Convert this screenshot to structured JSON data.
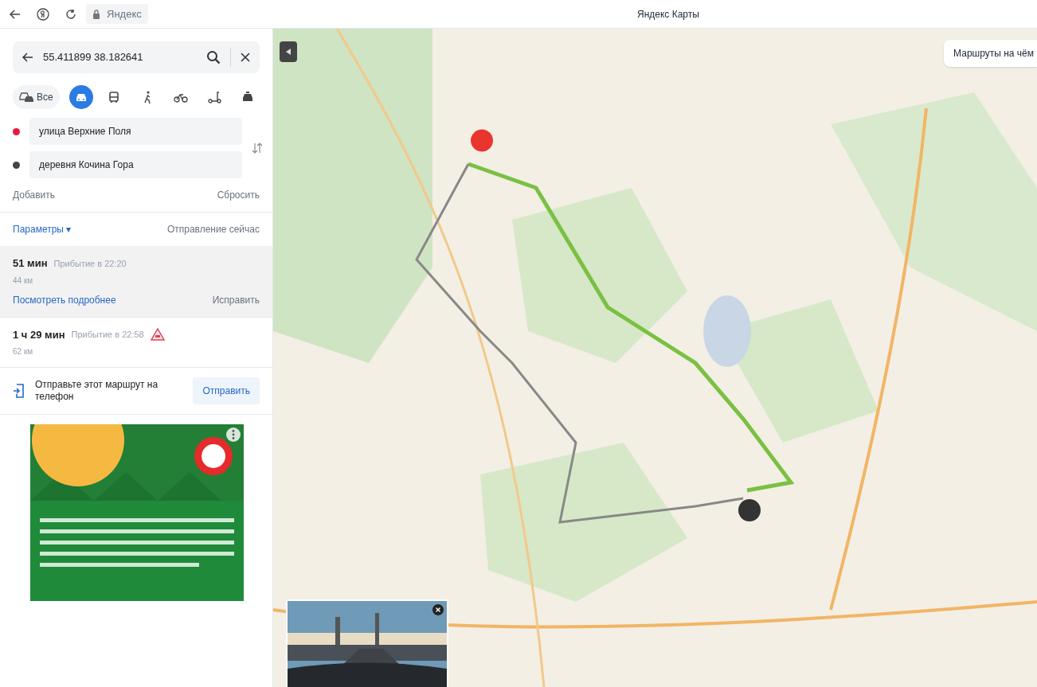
{
  "browser": {
    "address": "Яндекс",
    "title": "Яндекс Карты"
  },
  "search": {
    "value": "55.411899 38.182641"
  },
  "modes": [
    {
      "kind": "all",
      "label": "Все",
      "selected": false
    },
    {
      "kind": "car",
      "selected": true
    },
    {
      "kind": "bus",
      "selected": false
    },
    {
      "kind": "walk",
      "selected": false
    },
    {
      "kind": "bike",
      "selected": false
    },
    {
      "kind": "scooter",
      "selected": false
    },
    {
      "kind": "taxi",
      "selected": false
    }
  ],
  "waypoints": [
    {
      "value": "улица Верхние Поля",
      "color": "#e8193c"
    },
    {
      "value": "деревня Кочина Гора",
      "color": "#444444"
    }
  ],
  "add_label": "Добавить",
  "reset_label": "Сбросить",
  "params_label": "Параметры ▾",
  "departure": "Отправление сейчас",
  "routes": [
    {
      "duration": "51 мин",
      "arrival": "Прибытие в 22:20",
      "distance": "44 км",
      "selected": true,
      "warning": false,
      "details_link": "Посмотреть подробнее",
      "fix_link": "Исправить"
    },
    {
      "duration": "1 ч 29 мин",
      "arrival": "Прибытие в 22:58",
      "distance": "62 км",
      "selected": false,
      "warning": true
    }
  ],
  "send": {
    "text": "Отправьте этот маршрут на телефон",
    "button": "Отправить"
  },
  "map": {
    "transport_button": "Маршруты на чём"
  }
}
